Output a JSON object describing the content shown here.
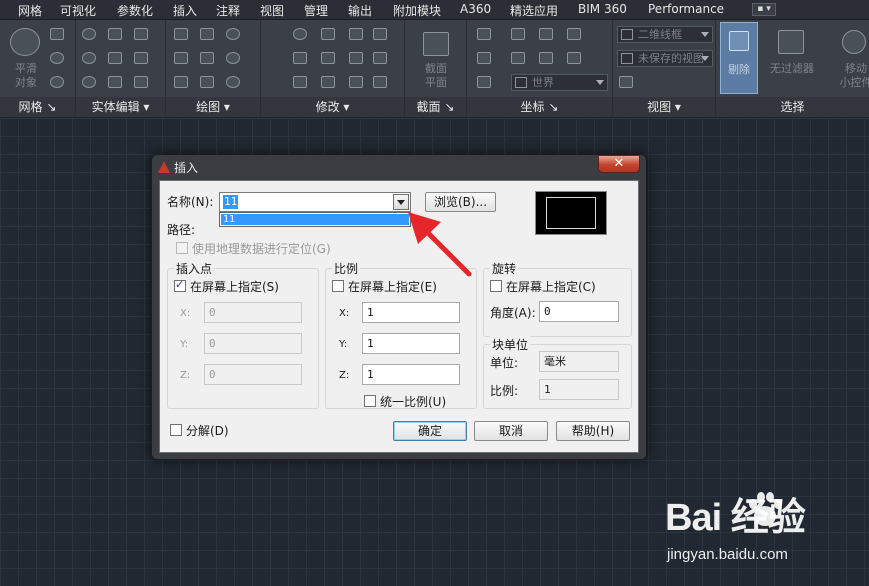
{
  "menubar": {
    "items": [
      "网格",
      "可视化",
      "参数化",
      "插入",
      "注释",
      "视图",
      "管理",
      "输出",
      "附加模块",
      "A360",
      "精选应用",
      "BIM 360",
      "Performance"
    ]
  },
  "ribbon": {
    "panels": [
      "网格",
      "实体编辑",
      "绘图",
      "修改",
      "截面",
      "坐标",
      "视图",
      "选择"
    ],
    "big_buttons": {
      "smooth_object": "平滑\n对象",
      "section_plane": "截面\n平面",
      "culling": "剔除",
      "no_filter": "无过滤器",
      "move_gizmo": "移动\n小控件"
    },
    "visual_style": "二维线框",
    "view_unsaved": "未保存的视图",
    "ucs_world": "世界"
  },
  "dialog": {
    "title": "插入",
    "close_label": "✕",
    "name_label": "名称(N):",
    "name_value": "11",
    "name_dropdown_option": "11",
    "browse_label": "浏览(B)...",
    "path_label": "路径:",
    "geo_label": "使用地理数据进行定位(G)",
    "insertion": {
      "title": "插入点",
      "specify_on_screen": "在屏幕上指定(S)",
      "x_label": "X:",
      "x_value": "0",
      "y_label": "Y:",
      "y_value": "0",
      "z_label": "Z:",
      "z_value": "0"
    },
    "scale": {
      "title": "比例",
      "specify_on_screen": "在屏幕上指定(E)",
      "x_label": "X:",
      "x_value": "1",
      "y_label": "Y:",
      "y_value": "1",
      "z_label": "Z:",
      "z_value": "1",
      "uniform_label": "统一比例(U)"
    },
    "rotation": {
      "title": "旋转",
      "specify_on_screen": "在屏幕上指定(C)",
      "angle_label": "角度(A):",
      "angle_value": "0"
    },
    "block_unit": {
      "title": "块单位",
      "unit_label": "单位:",
      "unit_value": "毫米",
      "factor_label": "比例:",
      "factor_value": "1"
    },
    "explode_label": "分解(D)",
    "ok_label": "确定",
    "cancel_label": "取消",
    "help_label": "帮助(H)"
  },
  "watermark": {
    "logo": "Bai 经验",
    "url": "jingyan.baidu.com"
  },
  "colors": {
    "ribbon_bg": "#3b4047",
    "canvas_bg": "#212831",
    "arrow": "#e6262b",
    "selection": "#3399ff"
  }
}
